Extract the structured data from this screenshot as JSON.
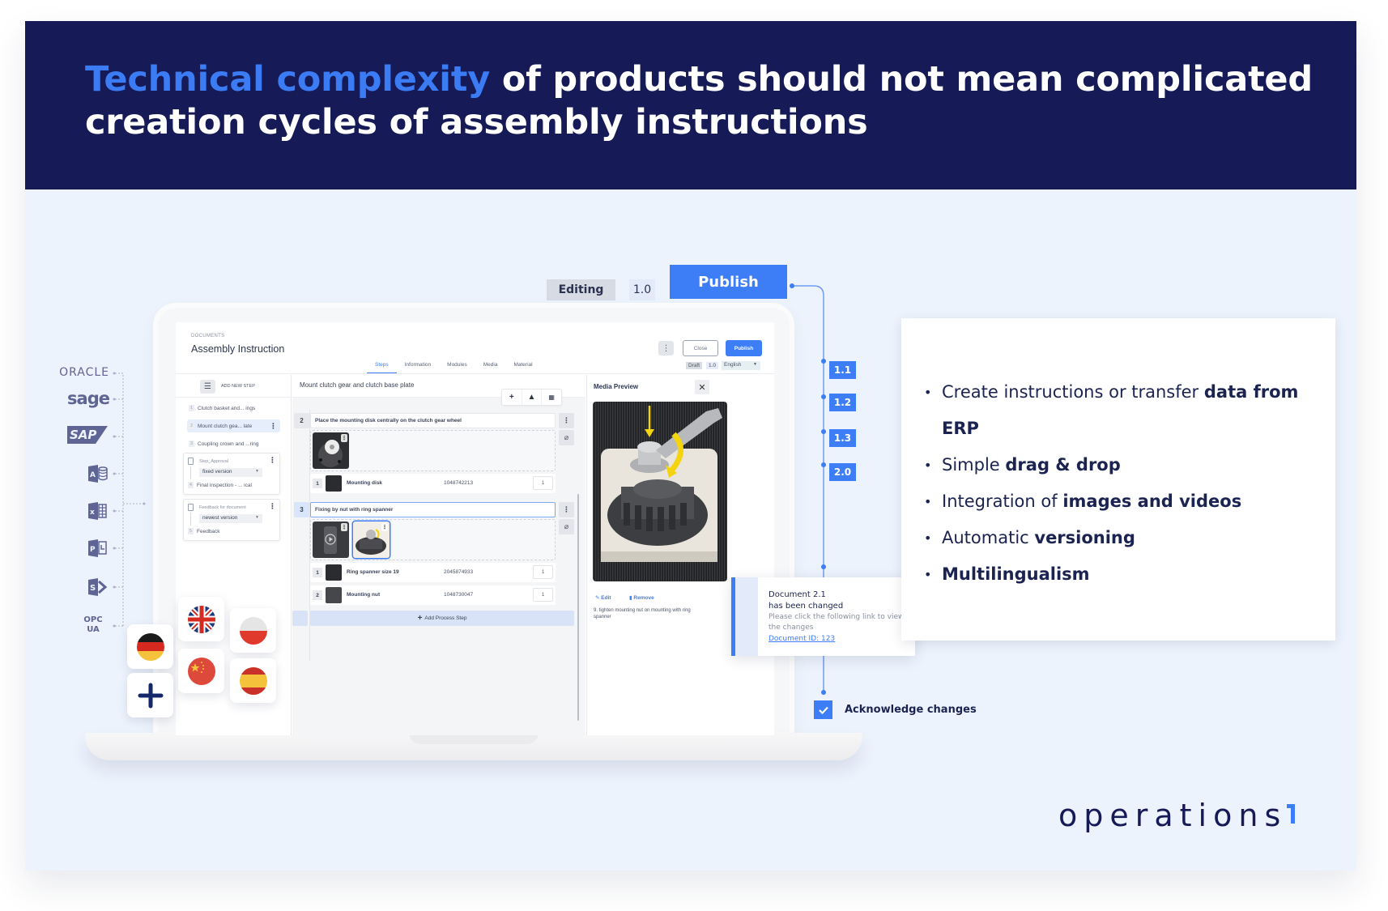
{
  "banner": {
    "title_accent": "Technical complexity",
    "title_rest": " of products should not mean complicated creation cycles of assembly instructions"
  },
  "version_strip": {
    "status": "Editing",
    "version": "1.0",
    "publish_label": "Publish"
  },
  "timeline": {
    "versions": [
      "1.1",
      "1.2",
      "1.3",
      "2.0"
    ],
    "acknowledge_label": "Acknowledge changes",
    "acknowledge_checked": true
  },
  "integrations": {
    "sources": [
      "ORACLE",
      "sage",
      "SAP",
      "Microsoft Access",
      "Microsoft Excel",
      "Microsoft Project",
      "Microsoft SharePoint",
      "OPC UA"
    ]
  },
  "languages": {
    "flags": [
      "German",
      "English (UK)",
      "Polish",
      "Chinese",
      "Spanish"
    ],
    "add_label": "+"
  },
  "app": {
    "breadcrumb": "DOCUMENTS",
    "title": "Assembly Instruction",
    "tabs": [
      {
        "label": "Steps",
        "active": true
      },
      {
        "label": "Information",
        "active": false
      },
      {
        "label": "Modules",
        "active": false
      },
      {
        "label": "Media",
        "active": false
      },
      {
        "label": "Material",
        "active": false
      }
    ],
    "close_label": "Close",
    "publish_label": "Publish",
    "state_badge": "Draft",
    "version_badge": "1.0",
    "language": "English",
    "add_step_label": "ADD NEW STEP",
    "steps": [
      {
        "num": "1",
        "label": "Clutch basket and... ings"
      },
      {
        "num": "2",
        "label": "Mount clutch gea... late",
        "active": true
      },
      {
        "num": "3",
        "label": "Coupling crown and ...ring"
      }
    ],
    "groups": [
      {
        "title": "Step_Approval",
        "select": "fixed version",
        "step_num": "4",
        "step_label": "Final inspection - ... ical"
      },
      {
        "title": "Feedback for document",
        "select": "newest version",
        "step_num": "5",
        "step_label": "Feedback"
      }
    ],
    "current_step_title": "Mount clutch gear and clutch base plate",
    "process_steps": [
      {
        "num": "2",
        "text": "Place the mounting disk centrally on the clutch gear wheel",
        "materials": [
          {
            "num": "1",
            "name": "Mounting disk",
            "code": "1048742213",
            "qty": "1"
          }
        ]
      },
      {
        "num": "3",
        "text": "Fixing by nut with ring spanner",
        "materials": [
          {
            "num": "1",
            "name": "Ring spanner size 19",
            "code": "2045874933",
            "qty": "1"
          },
          {
            "num": "2",
            "name": "Mounting nut",
            "code": "1048730047",
            "qty": "1"
          }
        ]
      }
    ],
    "add_process_step_label": "Add Process Step",
    "media_preview": {
      "title": "Media Preview",
      "edit_label": "Edit",
      "remove_label": "Remove",
      "caption": "9. tighten mounting nut on mounting with ring spanner"
    }
  },
  "notification": {
    "title_line1": "Document 2.1",
    "title_line2": "has been changed",
    "body": "Please click the following link to view the changes",
    "link": "Document ID: 123"
  },
  "features": {
    "items": [
      {
        "plain": "Create instructions or transfer ",
        "bold": "data from ERP"
      },
      {
        "plain": "Simple ",
        "bold": "drag & drop"
      },
      {
        "plain": "Integration of ",
        "bold": "images and videos"
      },
      {
        "plain": "Automatic ",
        "bold": "versioning"
      },
      {
        "plain": "",
        "bold": "Multilingualism"
      }
    ]
  },
  "brand": {
    "name": "operations"
  },
  "colors": {
    "navy": "#161a57",
    "accent": "#3d7df5",
    "background": "#edf3fd"
  }
}
